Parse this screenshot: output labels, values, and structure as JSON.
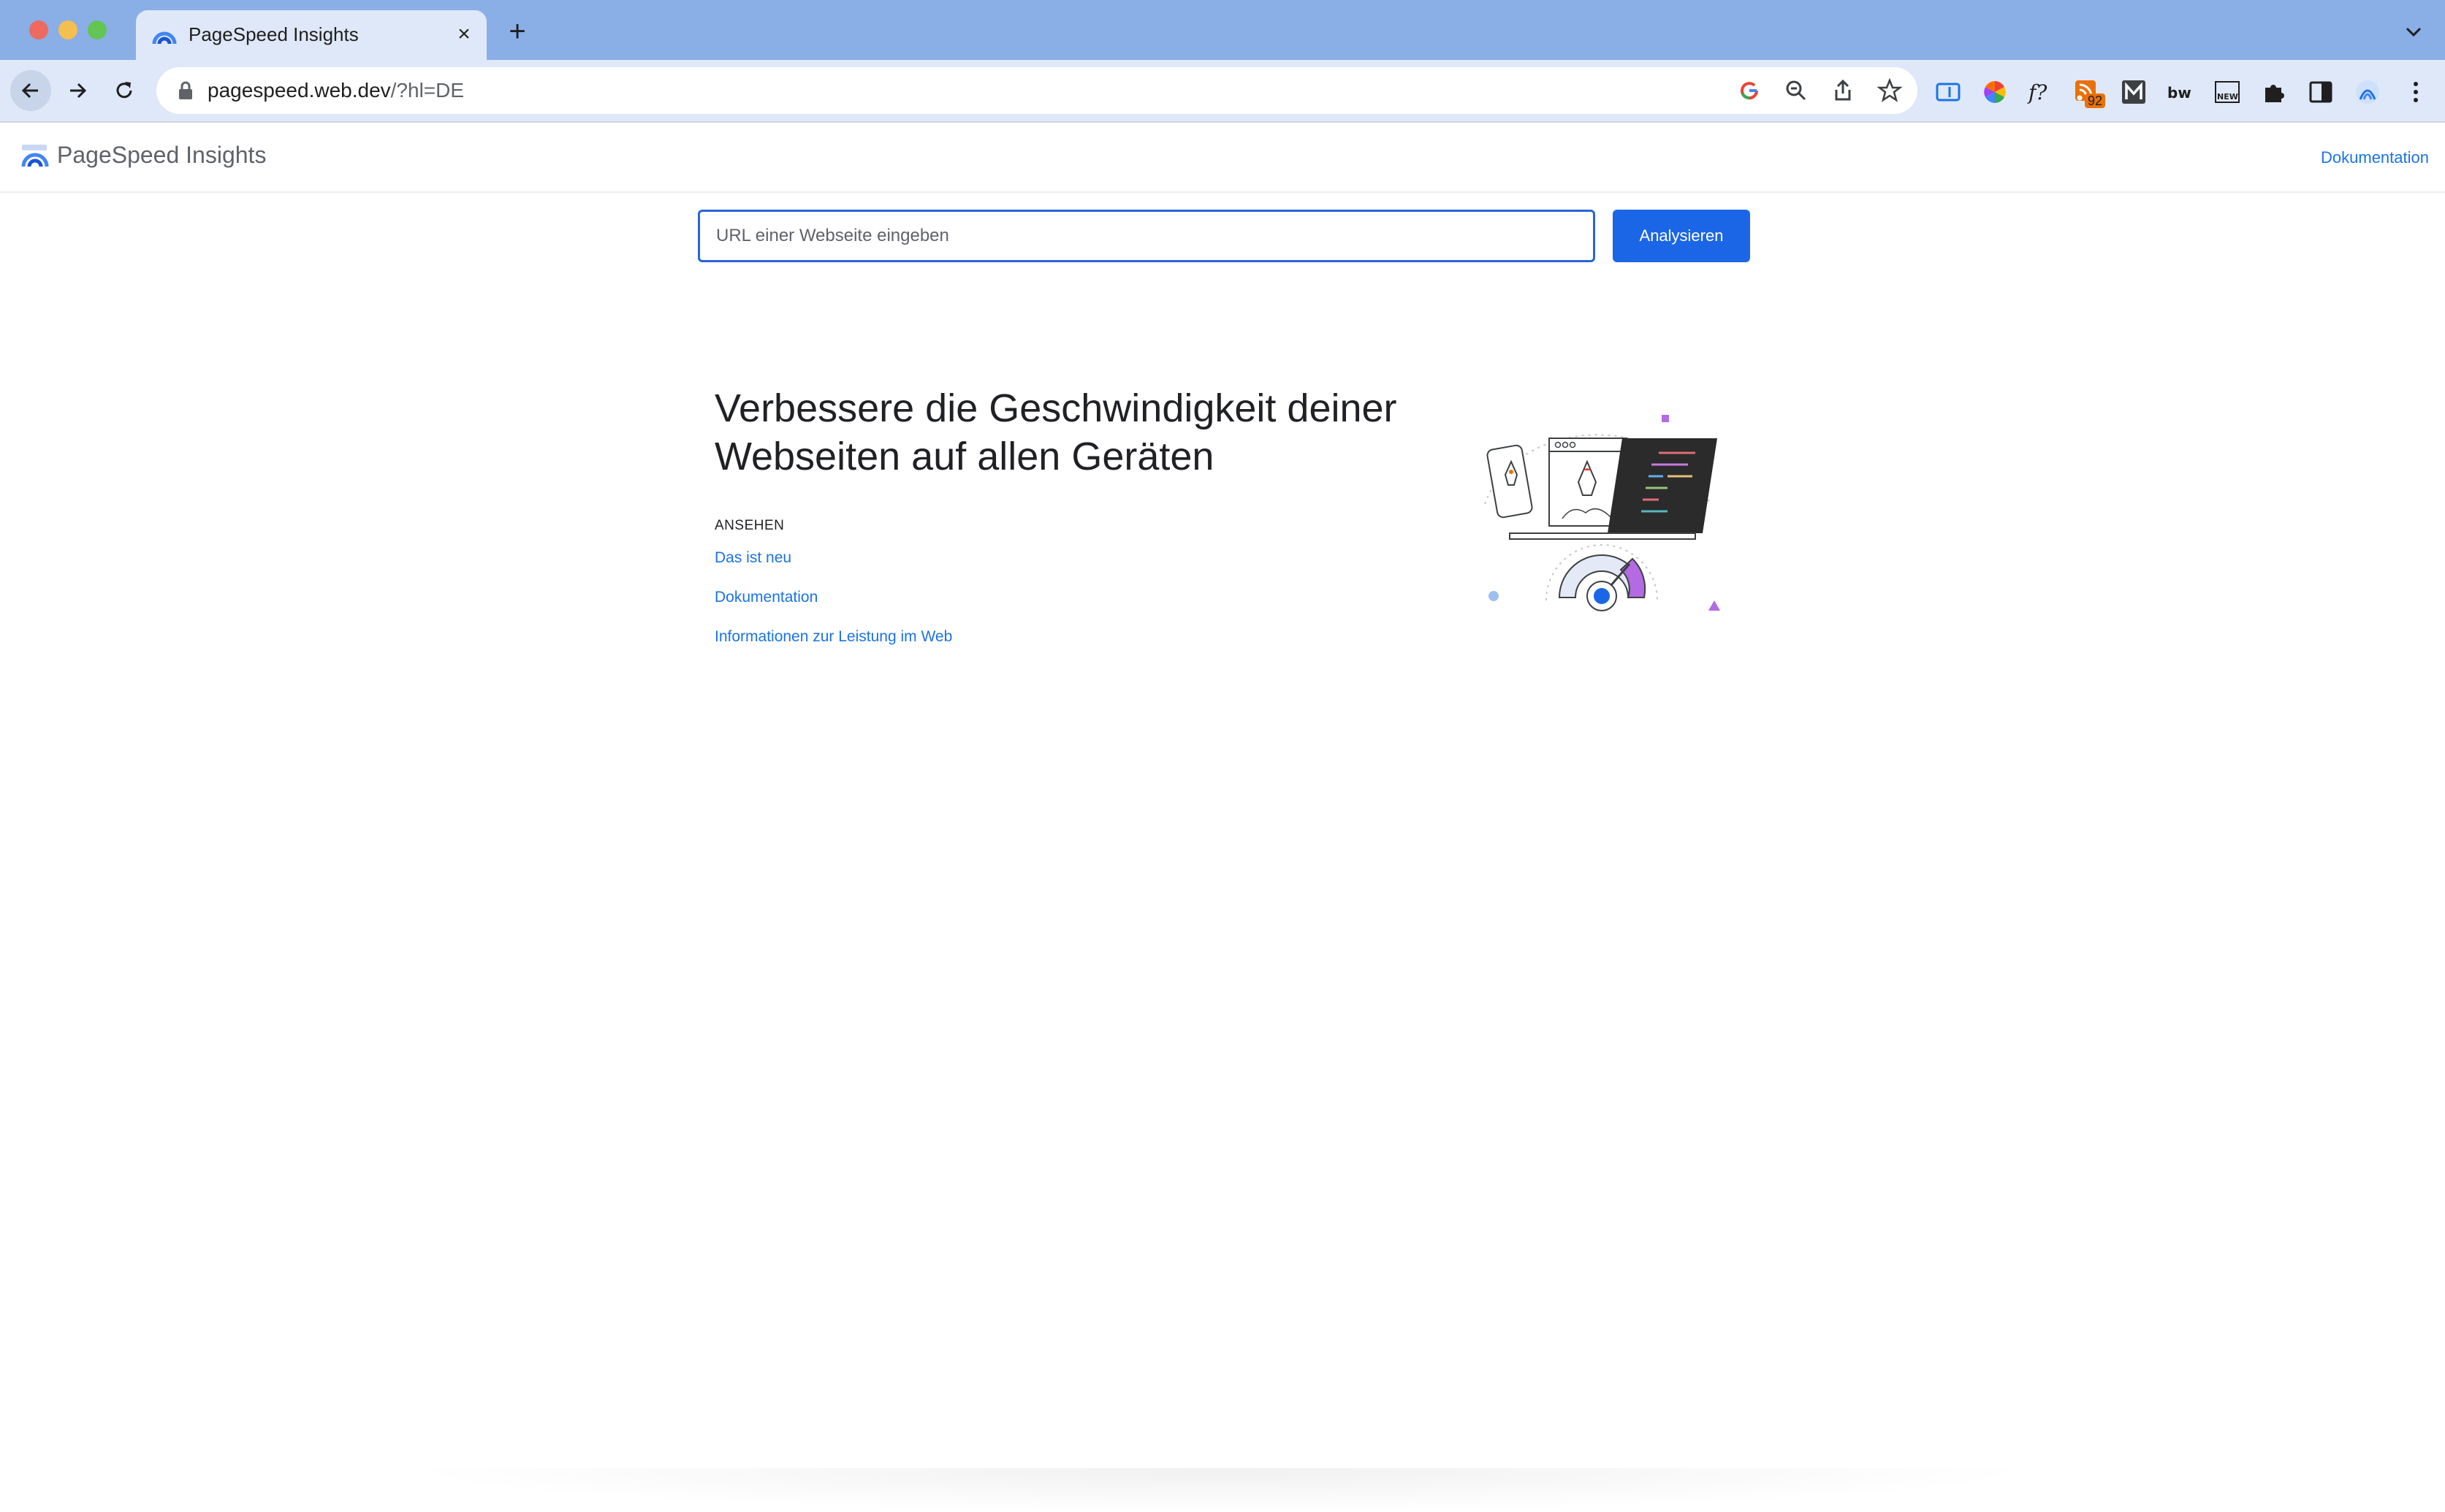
{
  "browser": {
    "tab_title": "PageSpeed Insights",
    "url_host": "pagespeed.web.dev",
    "url_rest": "/?hl=DE",
    "extension_badge": "92",
    "accent": "#8aaee6"
  },
  "header": {
    "brand": "PageSpeed Insights",
    "doc_link": "Dokumentation"
  },
  "search": {
    "placeholder": "URL einer Webseite eingeben",
    "button_label": "Analysieren"
  },
  "hero": {
    "title": "Verbessere die Geschwindigkeit deiner Webseiten auf allen Geräten",
    "section_label": "ANSEHEN",
    "links": [
      {
        "label": "Das ist neu"
      },
      {
        "label": "Dokumentation"
      },
      {
        "label": "Informationen zur Leistung im Web"
      }
    ]
  },
  "colors": {
    "primary": "#1b66e6",
    "link": "#1a73e8",
    "text": "#202124"
  }
}
